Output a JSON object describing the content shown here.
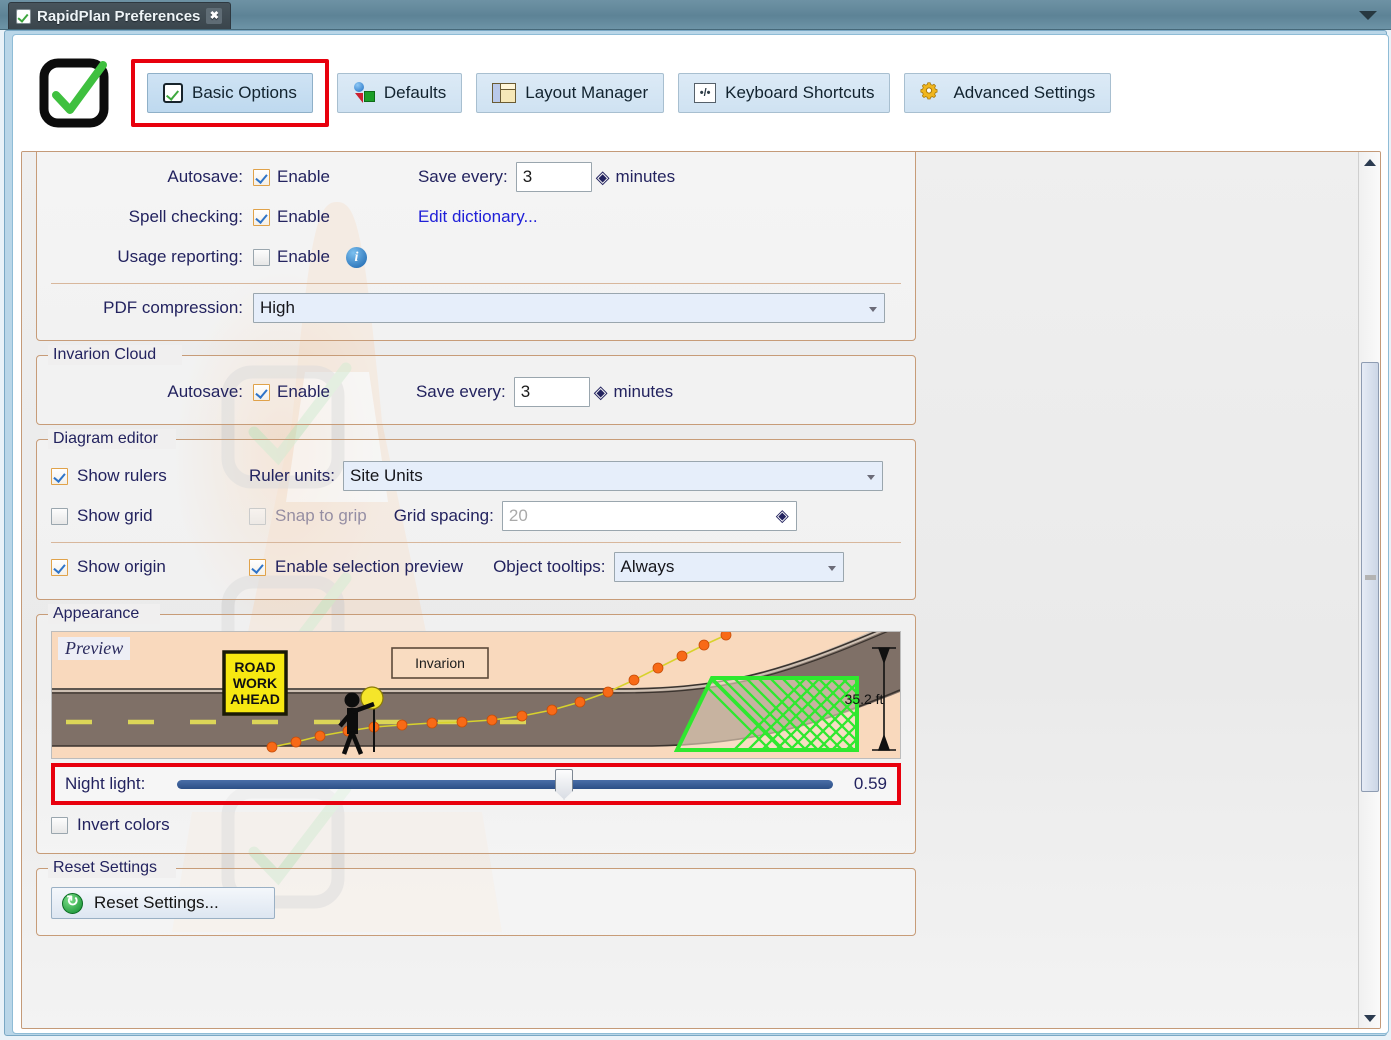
{
  "window": {
    "title": "RapidPlan Preferences",
    "close_label": "✖",
    "tab_icon": "checkbox-check-icon",
    "dropdown_icon": "chevron-down-icon"
  },
  "toolbar": {
    "logo_icon": "rapidplan-checkmark-logo",
    "buttons": [
      {
        "label": "Basic Options",
        "icon": "checkbox-check-icon",
        "active": true,
        "highlighted": true
      },
      {
        "label": "Defaults",
        "icon": "shapes-icon",
        "active": false,
        "highlighted": false
      },
      {
        "label": "Layout Manager",
        "icon": "layout-panes-icon",
        "active": false,
        "highlighted": false
      },
      {
        "label": "Keyboard Shortcuts",
        "icon": "keyboard-keys-icon",
        "active": false,
        "highlighted": false
      },
      {
        "label": "Advanced Settings",
        "icon": "gear-icon",
        "active": false,
        "highlighted": false
      }
    ]
  },
  "general": {
    "autosave_label": "Autosave:",
    "autosave_enable_label": "Enable",
    "autosave_checked": true,
    "save_every_label": "Save every:",
    "save_every_value": "3",
    "minutes_label": "minutes",
    "spell_label": "Spell checking:",
    "spell_enable_label": "Enable",
    "spell_checked": true,
    "edit_dictionary_label": "Edit dictionary...",
    "usage_label": "Usage reporting:",
    "usage_enable_label": "Enable",
    "usage_checked": false,
    "info_icon": "info-icon",
    "pdf_label": "PDF compression:",
    "pdf_value": "High"
  },
  "invarion_cloud": {
    "title": "Invarion Cloud",
    "autosave_label": "Autosave:",
    "autosave_enable_label": "Enable",
    "autosave_checked": true,
    "save_every_label": "Save every:",
    "save_every_value": "3",
    "minutes_label": "minutes"
  },
  "diagram_editor": {
    "title": "Diagram editor",
    "show_rulers_label": "Show rulers",
    "show_rulers_checked": true,
    "ruler_units_label": "Ruler units:",
    "ruler_units_value": "Site Units",
    "show_grid_label": "Show grid",
    "show_grid_checked": false,
    "snap_to_grip_label": "Snap to grip",
    "snap_to_grip_checked": false,
    "grid_spacing_label": "Grid spacing:",
    "grid_spacing_value": "20",
    "show_origin_label": "Show origin",
    "show_origin_checked": true,
    "selection_preview_label": "Enable selection preview",
    "selection_preview_checked": true,
    "object_tooltips_label": "Object tooltips:",
    "object_tooltips_value": "Always"
  },
  "appearance": {
    "title": "Appearance",
    "preview_label": "Preview",
    "preview_sign_text": "ROAD WORK AHEAD",
    "preview_sign_lines": [
      "ROAD",
      "WORK",
      "AHEAD"
    ],
    "preview_textbox_label": "Invarion",
    "preview_dimension_label": "35.2 ft",
    "night_light_label": "Night light:",
    "night_light_value": "0.59",
    "night_light_percent": 59,
    "invert_colors_label": "Invert colors",
    "invert_colors_checked": false,
    "highlighted": true
  },
  "reset": {
    "title": "Reset Settings",
    "button_label": "Reset Settings...",
    "button_icon": "refresh-icon"
  },
  "scrollbar": {
    "up_icon": "triangle-up-icon",
    "down_icon": "triangle-down-icon"
  },
  "colors": {
    "highlight": "#e8000d",
    "link": "#2020d8",
    "group_border": "#c79c78",
    "label": "#23235f"
  }
}
